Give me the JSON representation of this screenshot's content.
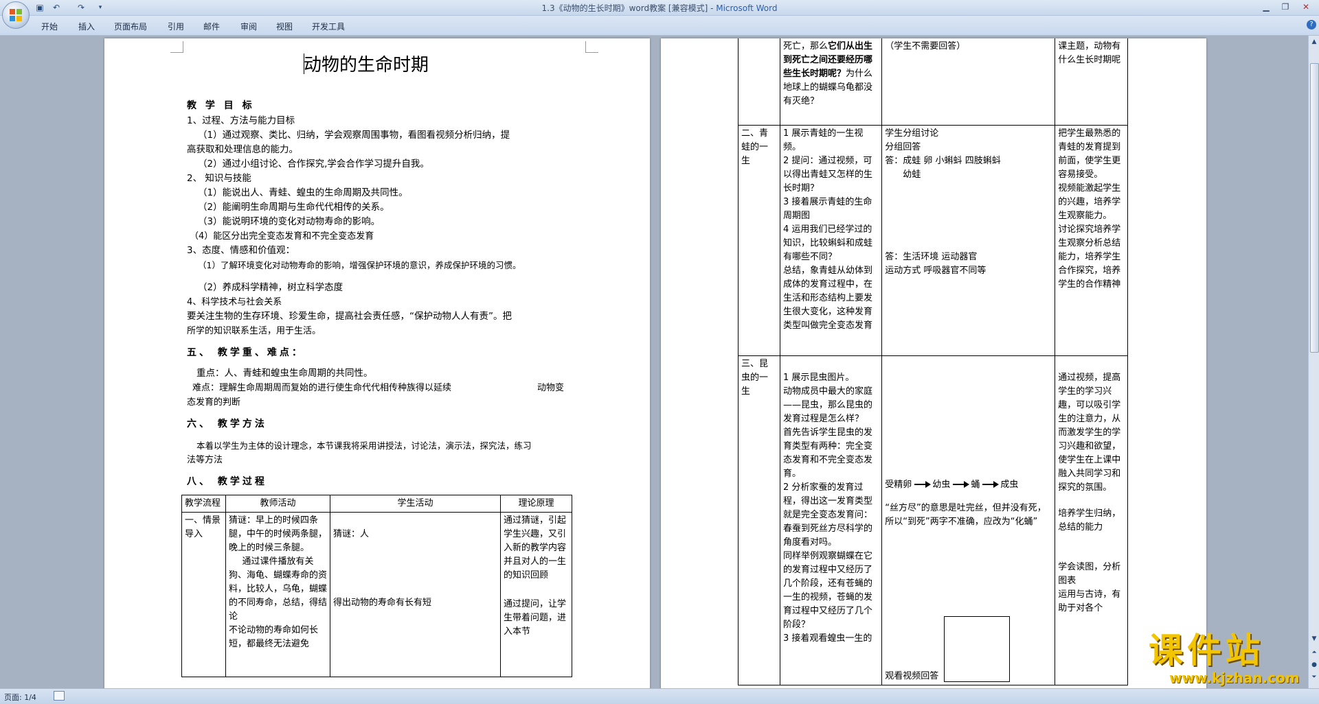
{
  "window": {
    "title_doc": "1.3《动物的生长时期》word教案 [兼容模式] - ",
    "title_app": "Microsoft Word"
  },
  "ribbon": {
    "tabs": [
      "开始",
      "插入",
      "页面布局",
      "引用",
      "邮件",
      "审阅",
      "视图",
      "开发工具"
    ]
  },
  "status": {
    "page_info": "页面: 1/4"
  },
  "watermark": {
    "cn": "课件站",
    "url": "www.kjzhan.com"
  },
  "page1": {
    "title": "动物的生命时期",
    "lines": [
      "教 学 目 标",
      "1、过程、方法与能力目标",
      "（1）通过观察、类比、归纳，学会观察周围事物，看图看视频分析归纳，提",
      "高获取和处理信息的能力。",
      "（2）通过小组讨论、合作探究,学会合作学习提升自我。",
      "2、 知识与技能",
      "（1）能说出人、青蛙、蝗虫的生命周期及共同性。",
      "（2）能阐明生命周期与生命代代相传的关系。",
      "（3）能说明环境的变化对动物寿命的影响。",
      "（4）能区分出完全变态发育和不完全变态发育",
      "3、态度、情感和价值观：",
      "（1）了解环境变化对动物寿命的影响，增强保护环境的意识，养成保护环境的习惯。",
      "（2）养成科学精神，树立科学态度",
      "4、科学技术与社会关系",
      "要关注生物的生存环境、珍爱生命，提高社会责任感，“保护动物人人有责”。把",
      "所学的知识联系生活，用于生活。",
      "五、 教学重、难点：",
      "重点：人、青蛙和蝗虫生命周期的共同性。",
      "难点：理解生命周期周而复始的进行使生命代代相传种族得以延续",
      "动物变",
      "态发育的判断",
      "六、 教学方法",
      "本着以学生为主体的设计理念，本节课我将采用讲授法，讨论法，演示法，探究法，练习",
      "法等方法",
      "八、 教学过程"
    ],
    "table_headers": [
      "教学流程",
      "教师活动",
      "学生活动",
      "理论原理"
    ],
    "row1": {
      "stage": "一、情景导入",
      "teacher_a": "猜谜：早上的时候四条腿，中午的时候两条腿，晚上的时候三条腿。",
      "teacher_b": "通过课件播放有关狗、海龟、蝴蝶寿命的资料，比较人，乌龟，蝴蝶的不同寿命，总结，得结论",
      "teacher_c": "不论动物的寿命如何长短，都最终无法避免",
      "student_a": "猜谜：人",
      "student_b": "得出动物的寿命有长有短",
      "theory_a": "通过猜谜，引起学生兴趣，又引入新的教学内容",
      "theory_b": "并且对人的一生的知识回顾",
      "theory_c": "通过提问，让学生带着问题，进入本节"
    }
  },
  "page2": {
    "row0": {
      "teacher_a": "死亡，那么",
      "teacher_bold": "它们从出生到死亡之间还要经历哪些生长时期呢？",
      "teacher_b": "为什么地球上的蝴蝶乌龟都没有灭绝？",
      "student": "（学生不需要回答）",
      "theory": "课主题，动物有什么生长时期呢"
    },
    "row1": {
      "stage": "二、青蛙的一生",
      "teacher": [
        "1 展示青蛙的一生视频。",
        "2 提问：通过视频，可以得出青蛙又怎样的生长时期？",
        "3 接着展示青蛙的生命周期图",
        "4 运用我们已经学过的知识，比较蝌蚪和成蛙有哪些不同？",
        "总结，象青蛙从幼体到成体的发育过程中，在生活和形态结构上要发生很大变化，这种发育类型叫做完全变态发育"
      ],
      "student": [
        "学生分组讨论",
        "分组回答",
        "答：成蛙  卵  小蝌蚪  四肢蝌蚪",
        "幼蛙",
        "答：生活环境  运动器官",
        "运动方式  呼吸器官不同等"
      ],
      "theory": [
        "把学生最熟悉的青蛙的发育提到前面，使学生更容易接受。",
        "视频能激起学生的兴趣，培养学生观察能力。",
        "讨论探究培养学生观察分析总结能力，培养学生合作探究，培养学生的合作精神"
      ]
    },
    "row2": {
      "stage": "三、昆虫的一生",
      "teacher": [
        "1 展示昆虫图片。",
        "动物成员中最大的家庭——昆虫，那么昆虫的发育过程是怎么样？",
        "首先告诉学生昆虫的发育类型有两种：完全变态发育和不完全变态发育。",
        "2 分析家蚕的发育过程，得出这一发育类型就是完全变态发育问：春蚕到死丝方尽科学的角度看对吗。",
        "同样举例观察蝴蝶在它的发育过程中又经历了几个阶段，还有苍蝇的一生的视频，苍蝇的发育过程中又经历了几个阶段？",
        "3 接着观看蝗虫一生的"
      ],
      "student_stages": [
        "受精卵",
        "幼虫",
        "蛹",
        "成虫"
      ],
      "student_note": "“丝方尽”的意思是吐完丝，但并没有死，所以“到死”两字不准确，应改为“化蛹”",
      "student_last": "观看视频回答",
      "theory": [
        "通过视频，提高学生的学习兴趣，可以吸引学生的注意力，从而激发学生的学习兴趣和欲望，使学生在上课中融入共同学习和探究的氛围。",
        "培养学生归纳，总结的能力",
        "学会读图，分析图表",
        "运用与古诗，有助于对各个"
      ]
    }
  }
}
